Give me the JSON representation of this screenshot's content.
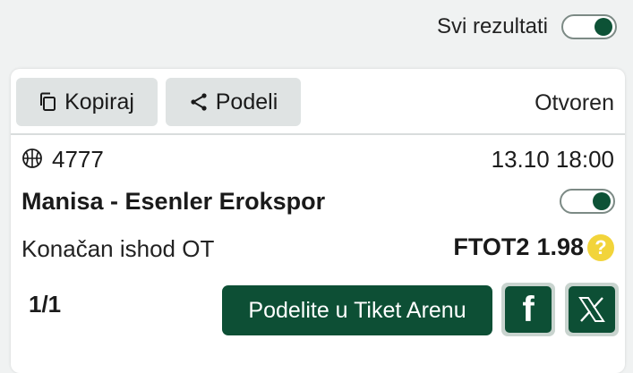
{
  "header": {
    "all_results_label": "Svi rezultati",
    "all_results_on": true
  },
  "ticket": {
    "copy_label": "Kopiraj",
    "share_label": "Podeli",
    "status": "Otvoren",
    "event_code": "4777",
    "sport_icon": "basketball-icon",
    "datetime": "13.10 18:00",
    "match": "Manisa - Esenler Erokspor",
    "match_toggle_on": true,
    "market": "Konačan ishod OT",
    "pick": "FTOT2",
    "odds": "1.98",
    "help_symbol": "?",
    "page_count": "1/1",
    "arena_button": "Podelite u Tiket Arenu",
    "facebook_glyph": "f"
  },
  "colors": {
    "brand_green": "#0d4f35",
    "help_yellow": "#f2d43a",
    "button_gray": "#dfe3e3"
  }
}
